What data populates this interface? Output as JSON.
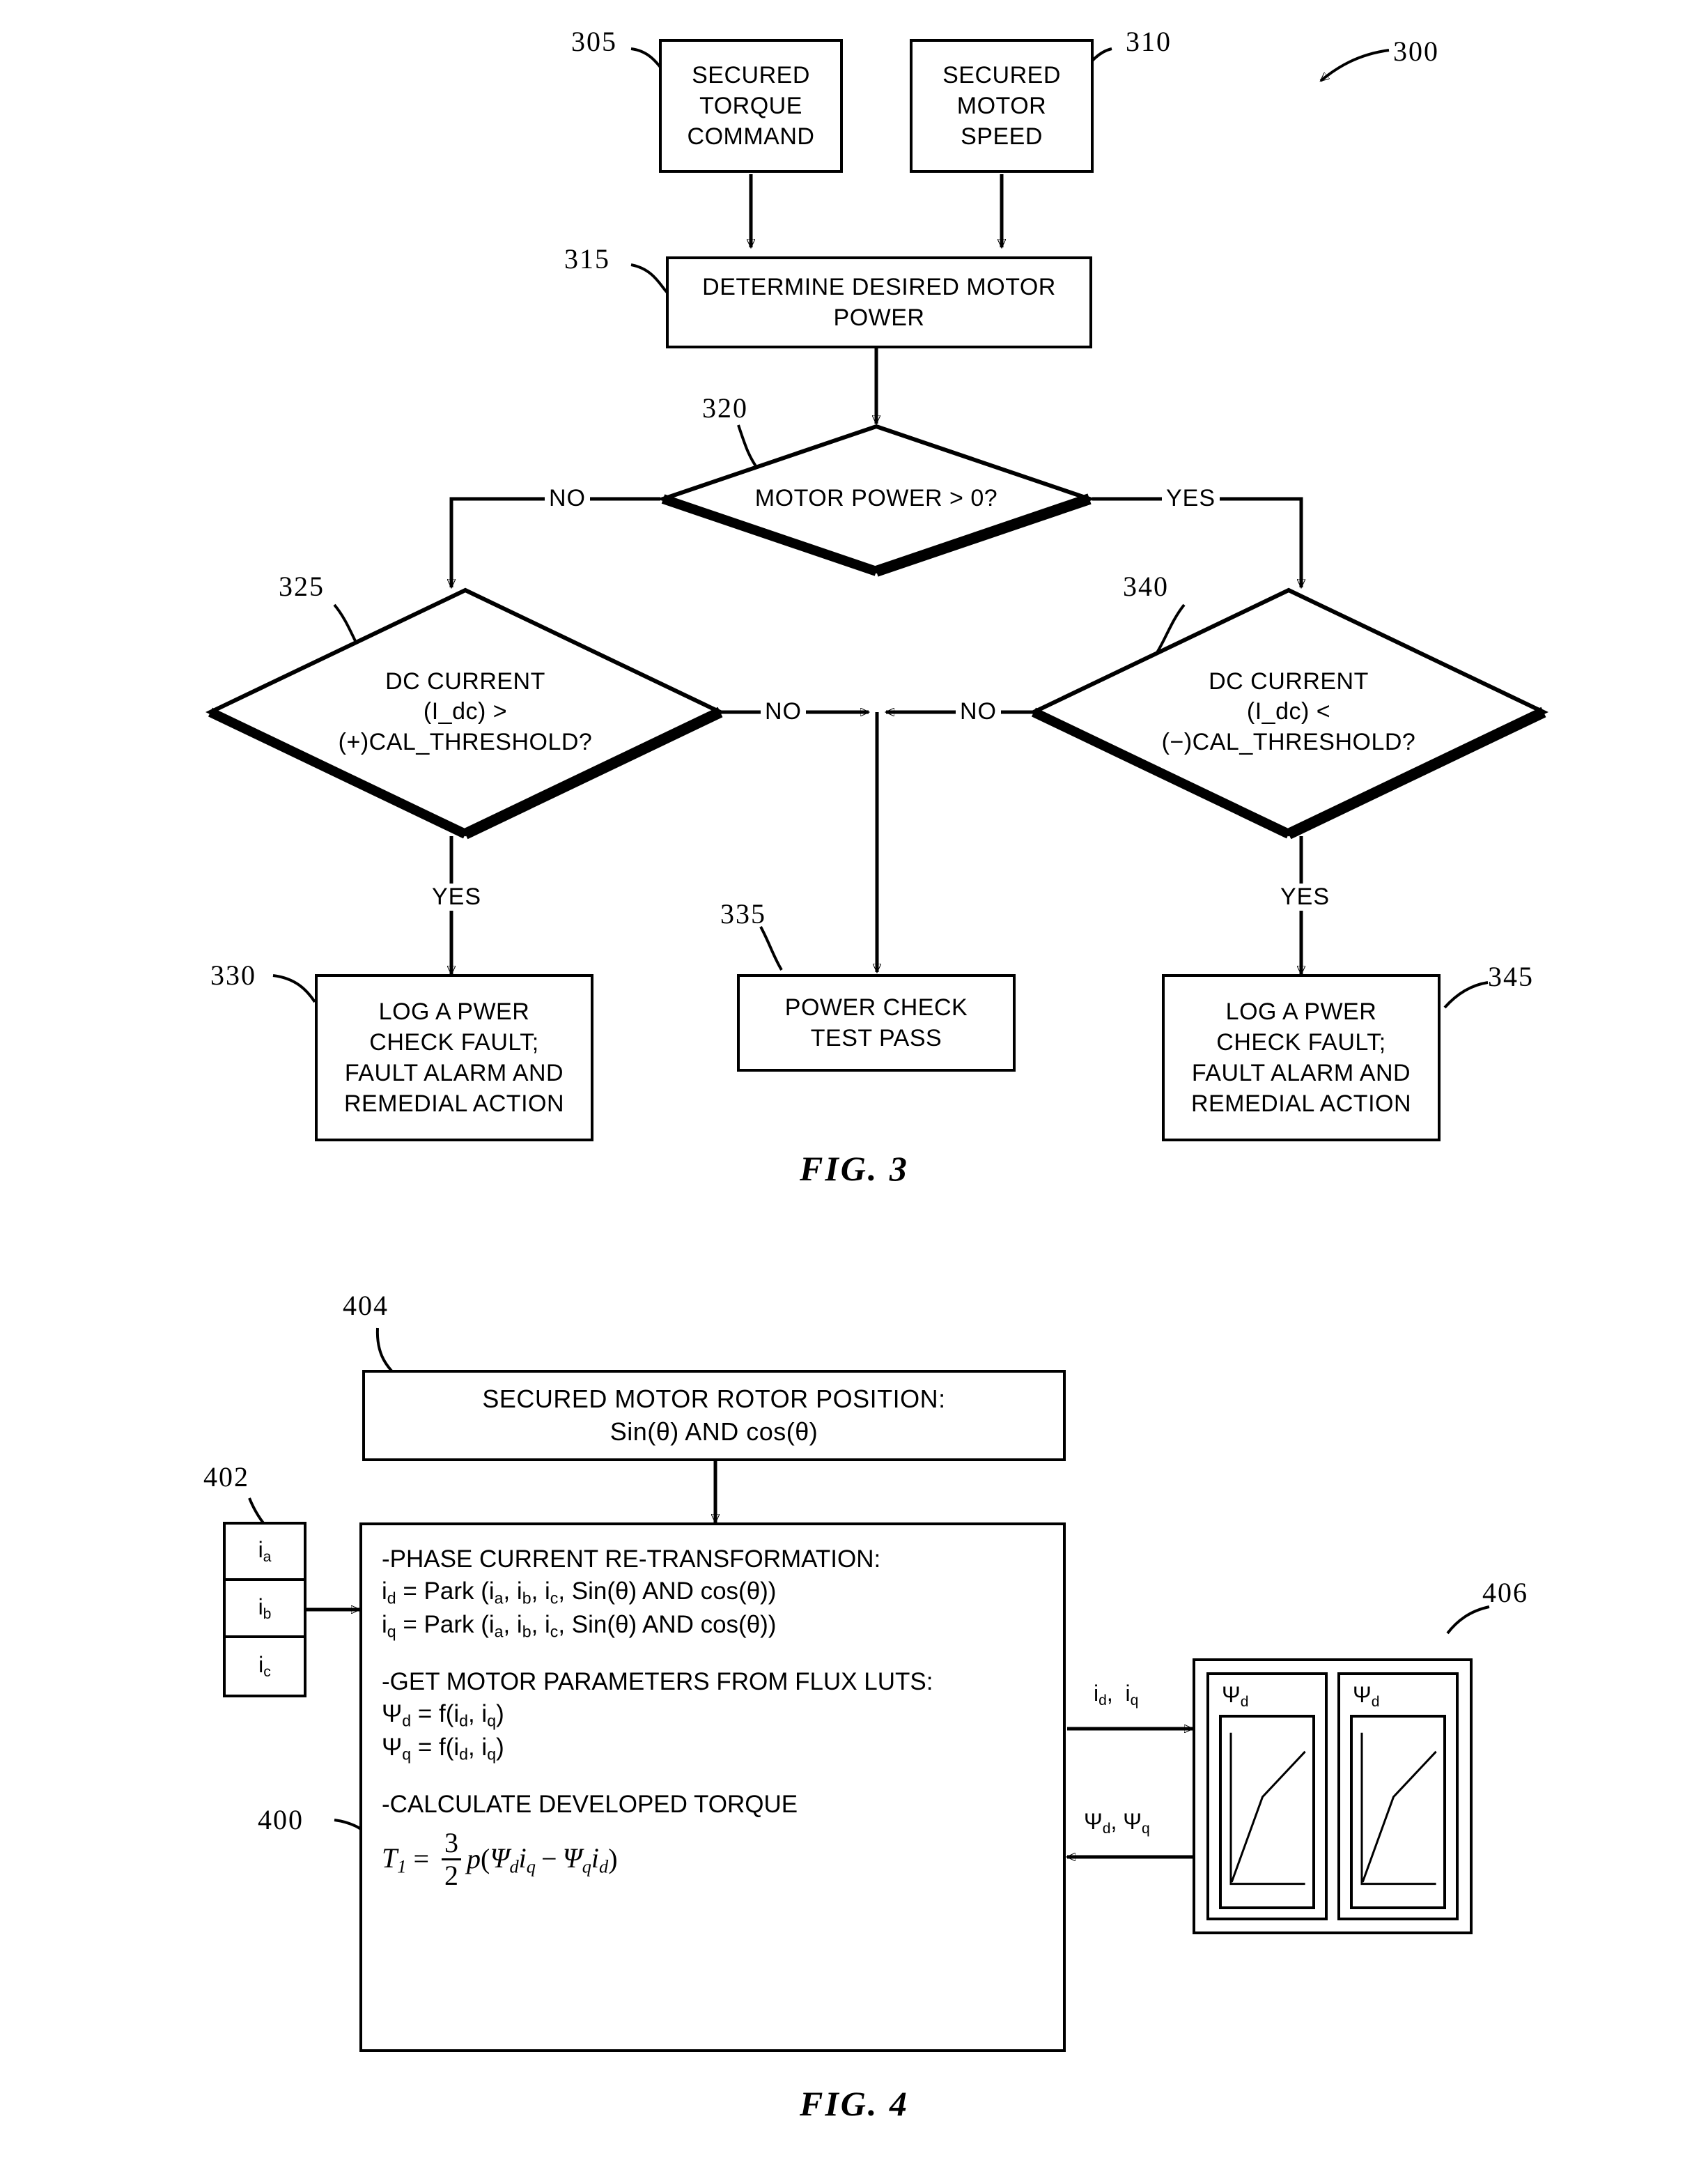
{
  "figures": [
    {
      "id": "fig3",
      "caption": "FIG. 3",
      "ref": "300"
    },
    {
      "id": "fig4",
      "caption": "FIG. 4",
      "ref": "400"
    }
  ],
  "fig3": {
    "caption": "FIG. 3",
    "diagram_ref": "300",
    "nodes": {
      "secured_torque_command": {
        "ref": "305",
        "text": "SECURED\nTORQUE\nCOMMAND",
        "type": "process"
      },
      "secured_motor_speed": {
        "ref": "310",
        "text": "SECURED\nMOTOR\nSPEED",
        "type": "process"
      },
      "determine_desired_motor_power": {
        "ref": "315",
        "text": "DETERMINE DESIRED MOTOR\nPOWER",
        "type": "process"
      },
      "motor_power_decision": {
        "ref": "320",
        "text": "MOTOR POWER > 0?",
        "type": "decision"
      },
      "dc_current_positive_decision": {
        "ref": "325",
        "text": "DC CURRENT\n(I_dc) >\n(+)CAL_THRESHOLD?",
        "type": "decision"
      },
      "log_pwer_check_fault_left": {
        "ref": "330",
        "text": "LOG A PWER\nCHECK FAULT;\nFAULT ALARM AND\nREMEDIAL ACTION",
        "type": "process"
      },
      "power_check_test_pass": {
        "ref": "335",
        "text": "POWER CHECK\nTEST PASS",
        "type": "process"
      },
      "dc_current_negative_decision": {
        "ref": "340",
        "text": "DC CURRENT\n(I_dc) <\n(−)CAL_THRESHOLD?",
        "type": "decision"
      },
      "log_pwer_check_fault_right": {
        "ref": "345",
        "text": "LOG A PWER\nCHECK FAULT;\nFAULT ALARM AND\nREMEDIAL ACTION",
        "type": "process"
      }
    },
    "edge_labels": {
      "motor_power_no": "NO",
      "motor_power_yes": "YES",
      "left_branch_no": "NO",
      "right_branch_no": "NO",
      "left_branch_yes": "YES",
      "right_branch_yes": "YES"
    }
  },
  "fig4": {
    "caption": "FIG. 4",
    "diagram_ref": "400",
    "nodes": {
      "rotor_position": {
        "ref": "404",
        "line1": "SECURED MOTOR ROTOR POSITION:",
        "line2": "Sin(θ) AND cos(θ)"
      },
      "phase_currents": {
        "ref": "402",
        "cells": [
          "iₐ",
          "iᵇ",
          "iᶜ"
        ],
        "cell_labels": [
          "ia",
          "ib",
          "ic"
        ]
      },
      "main_block": {
        "ref": "400",
        "section1_heading": "-PHASE CURRENT RE-TRANSFORMATION:",
        "section1_line1": "id = Park (ia, ib, ic, Sin(θ) AND cos(θ))",
        "section1_line2": "iq = Park (ia, ib, ic, Sin(θ) AND cos(θ))",
        "section2_heading": "-GET MOTOR PARAMETERS FROM FLUX LUTS:",
        "section2_line1": "Ψd = f(id, iq)",
        "section2_line2": "Ψq = f(id, iq)",
        "section3_heading": "-CALCULATE DEVELOPED TORQUE",
        "equation": "T1 = (3/2) p(Ψd iq − Ψq id)",
        "equation_parts": {
          "lhs": "T",
          "lhs_sub": "1",
          "eq": "=",
          "frac_num": "3",
          "frac_den": "2",
          "p": "p",
          "open": "(",
          "psi_d": "Ψ",
          "psi_d_sub": "d",
          "i_q": "i",
          "i_q_sub": "q",
          "minus": "−",
          "psi_q": "Ψ",
          "psi_q_sub": "q",
          "i_d": "i",
          "i_d_sub": "d",
          "close": ")"
        }
      },
      "flux_luts": {
        "ref": "406",
        "cards": [
          {
            "label_base": "Ψ",
            "label_sub": "d"
          },
          {
            "label_base": "Ψ",
            "label_sub": "d"
          }
        ]
      }
    },
    "edge_labels": {
      "to_lut_base": "i",
      "to_lut_text": "id,  iq",
      "from_lut_text": "Ψd, Ψq"
    }
  }
}
